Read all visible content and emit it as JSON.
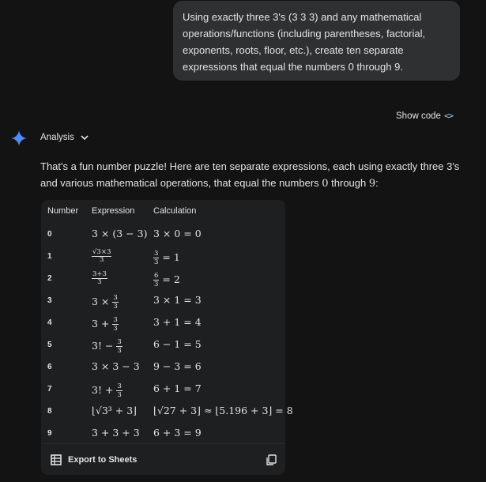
{
  "user_message": "Using exactly three 3's (3 3 3) and any mathematical operations/functions (including parentheses, factorial, exponents, roots, floor, etc.), create ten separate expressions that equal the numbers 0 through 9.",
  "show_code_label": "Show code",
  "analysis_label": "Analysis",
  "intro": {
    "before": "That's a fun number puzzle! Here are ten separate expressions, each using exactly three 3's and various mathematical operations, that equal the numbers ",
    "n0": "0",
    "mid": " through ",
    "n9": "9",
    "after": ":"
  },
  "table": {
    "headers": [
      "Number",
      "Expression",
      "Calculation"
    ],
    "rows": [
      {
        "number": "0",
        "expression": "3 × (3 − 3)",
        "calculation": "3 × 0 = 0"
      },
      {
        "number": "1",
        "expression_top": "√3×3",
        "expression_bottom": "3",
        "calculation": "= 1"
      },
      {
        "number": "2",
        "expression_top": "3+3",
        "expression_bottom": "3",
        "calculation": "= 2"
      },
      {
        "number": "3",
        "expression": "3 × ",
        "calculation": "3 × 1 = 3"
      },
      {
        "number": "4",
        "expression": "3 + ",
        "calculation": "3 + 1 = 4"
      },
      {
        "number": "5",
        "expression": "3! − ",
        "calculation": "6 − 1 = 5"
      },
      {
        "number": "6",
        "expression": "3 × 3 − 3",
        "calculation": "9 − 3 = 6"
      },
      {
        "number": "7",
        "expression": "3! + ",
        "calculation": "6 + 1 = 7"
      },
      {
        "number": "8",
        "expression": "⌊√3³ + 3⌋",
        "calculation": "⌊√27 + 3⌋ ≈ ⌊5.196 + 3⌋ = 8"
      },
      {
        "number": "9",
        "expression": "3 + 3 + 3",
        "calculation": "6 + 3 = 9"
      }
    ]
  },
  "export_label": "Export to Sheets"
}
